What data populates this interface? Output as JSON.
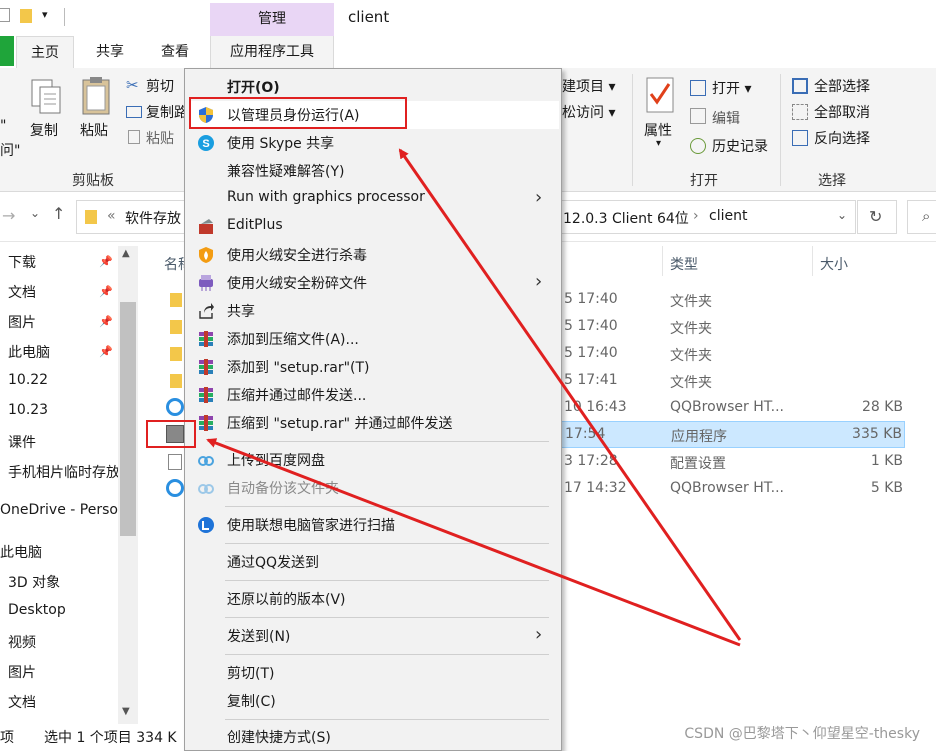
{
  "window": {
    "manage_tab": "管理",
    "title": "client"
  },
  "ribbon_tabs": {
    "home": "主页",
    "share": "共享",
    "view": "查看",
    "app_tools": "应用程序工具"
  },
  "ribbon": {
    "pin_partial": "\"",
    "access_partial": "问\"",
    "copy": "复制",
    "paste": "粘贴",
    "cut": "剪切",
    "copy_path_partial": "复制路",
    "paste_shortcut_partial": "粘贴",
    "clipboard_group": "剪贴板",
    "new_item_partial": "建项目 ▾",
    "easy_access_partial": "松访问 ▾",
    "properties": "属性",
    "open": "打开 ▾",
    "edit": "编辑",
    "history": "历史记录",
    "open_group": "打开",
    "select_all": "全部选择",
    "select_none": "全部取消",
    "invert_selection": "反向选择",
    "select_group": "选择"
  },
  "address": {
    "crumb_left": "软件存放",
    "crumb_right": "12.0.3 Client 64位",
    "crumb_sep": "›",
    "current": "client"
  },
  "nav": {
    "items": [
      "下载",
      "文档",
      "图片",
      "此电脑",
      "10.22",
      "10.23",
      "课件",
      "手机相片临时存放",
      "OneDrive - Perso",
      "此电脑",
      "3D 对象",
      "Desktop",
      "视频",
      "图片",
      "文档",
      "项"
    ]
  },
  "columns": {
    "name": "名称",
    "type": "类型",
    "size": "大小"
  },
  "files": [
    {
      "date": "5 17:40",
      "type": "文件夹",
      "size": ""
    },
    {
      "date": "5 17:40",
      "type": "文件夹",
      "size": ""
    },
    {
      "date": "5 17:40",
      "type": "文件夹",
      "size": ""
    },
    {
      "date": "5 17:41",
      "type": "文件夹",
      "size": ""
    },
    {
      "date": "10 16:43",
      "type": "QQBrowser HT...",
      "size": "28 KB"
    },
    {
      "date": "17:54",
      "type": "应用程序",
      "size": "335 KB"
    },
    {
      "date": "3 17:28",
      "type": "配置设置",
      "size": "1 KB"
    },
    {
      "date": "17 14:32",
      "type": "QQBrowser HT...",
      "size": "5 KB"
    }
  ],
  "status": {
    "selected": "选中 1 个项目  334 K"
  },
  "context_menu": {
    "open": "打开(O)",
    "run_as_admin": "以管理员身份运行(A)",
    "skype_share": "使用 Skype 共享",
    "compat": "兼容性疑难解答(Y)",
    "graphics": "Run with graphics processor",
    "editplus": "EditPlus",
    "huorong_scan": "使用火绒安全进行杀毒",
    "huorong_shred": "使用火绒安全粉碎文件",
    "share": "共享",
    "add_archive": "添加到压缩文件(A)...",
    "add_setup_rar": "添加到 \"setup.rar\"(T)",
    "compress_email": "压缩并通过邮件发送...",
    "compress_setup_email": "压缩到 \"setup.rar\" 并通过邮件发送",
    "baidu_upload": "上传到百度网盘",
    "auto_backup": "自动备份该文件夹",
    "lenovo_scan": "使用联想电脑管家进行扫描",
    "qq_send": "通过QQ发送到",
    "restore": "还原以前的版本(V)",
    "send_to": "发送到(N)",
    "cut": "剪切(T)",
    "copy": "复制(C)",
    "create_shortcut": "创建快捷方式(S)"
  },
  "watermark": "CSDN @巴黎塔下丶仰望星空-thesky",
  "colors": {
    "annotation_red": "#e02020",
    "selection": "#cce8ff",
    "manage_tab": "#e9d6f5"
  }
}
